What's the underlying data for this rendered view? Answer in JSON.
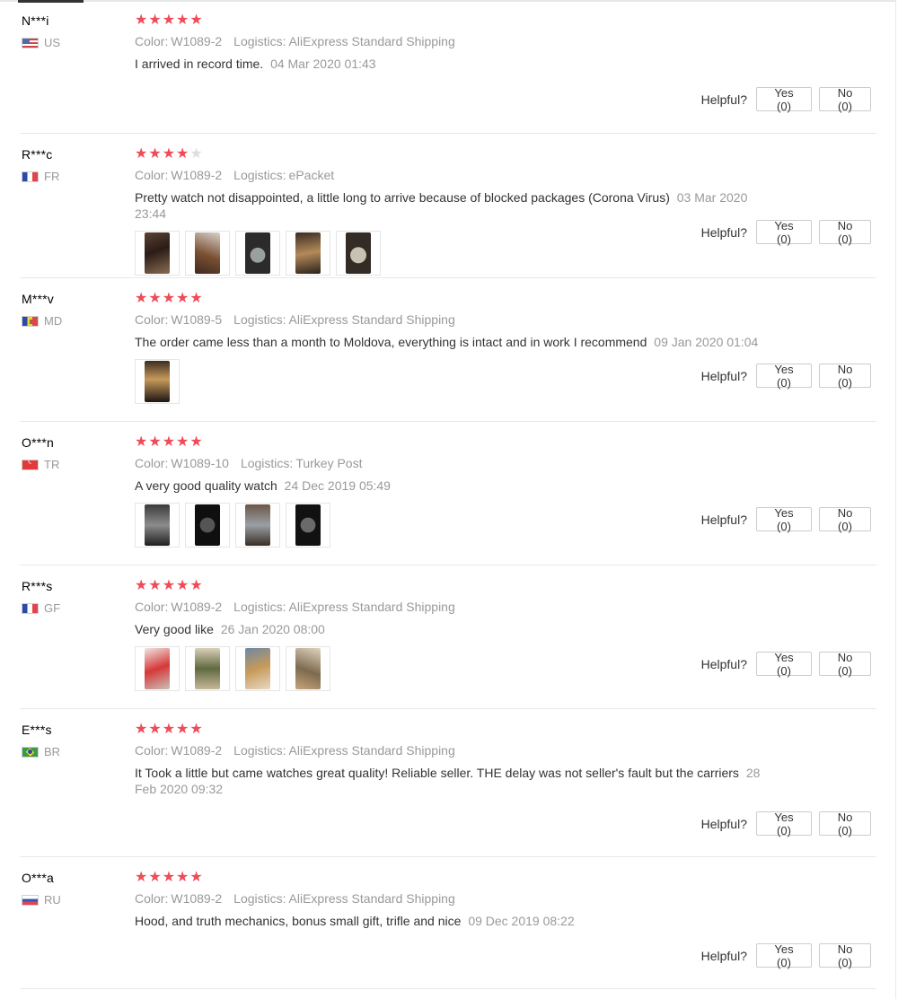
{
  "labels": {
    "color": "Color:",
    "logistics": "Logistics:",
    "helpful": "Helpful?"
  },
  "accent": {
    "star": "#ef4b59",
    "star_empty": "#dddddd"
  },
  "reviews": [
    {
      "user": "N***i",
      "country": "US",
      "flag_icon": "flag-us-icon",
      "rating": 5,
      "color": "W1089-2",
      "logistics": "AliExpress Standard Shipping",
      "text": "I arrived in record time.",
      "date": "04 Mar 2020 01:43",
      "photos": [],
      "yes": "Yes (0)",
      "no": "No (0)"
    },
    {
      "user": "R***c",
      "country": "FR",
      "flag_icon": "flag-fr-icon",
      "rating": 4,
      "color": "W1089-2",
      "logistics": "ePacket",
      "text": "Pretty watch not disappointed, a little long to arrive because of blocked packages (Corona Virus)",
      "date": "03 Mar 2020 23:44",
      "photos": [
        "t1",
        "t2",
        "t3",
        "t4",
        "t5"
      ],
      "yes": "Yes (0)",
      "no": "No (0)"
    },
    {
      "user": "M***v",
      "country": "MD",
      "flag_icon": "flag-md-icon",
      "rating": 5,
      "color": "W1089-5",
      "logistics": "AliExpress Standard Shipping",
      "text": "The order came less than a month to Moldova, everything is intact and in work I recommend",
      "date": "09 Jan 2020 01:04",
      "photos": [
        "t6"
      ],
      "yes": "Yes (0)",
      "no": "No (0)"
    },
    {
      "user": "O***n",
      "country": "TR",
      "flag_icon": "flag-tr-icon",
      "rating": 5,
      "color": "W1089-10",
      "logistics": "Turkey Post",
      "text": "A very good quality watch",
      "date": "24 Dec 2019 05:49",
      "photos": [
        "t7",
        "t8",
        "t9",
        "t10"
      ],
      "yes": "Yes (0)",
      "no": "No (0)"
    },
    {
      "user": "R***s",
      "country": "GF",
      "flag_icon": "flag-fr-icon",
      "rating": 5,
      "color": "W1089-2",
      "logistics": "AliExpress Standard Shipping",
      "text": "Very good like",
      "date": "26 Jan 2020 08:00",
      "photos": [
        "t11",
        "t12",
        "t13",
        "t14"
      ],
      "yes": "Yes (0)",
      "no": "No (0)"
    },
    {
      "user": "E***s",
      "country": "BR",
      "flag_icon": "flag-br-icon",
      "rating": 5,
      "color": "W1089-2",
      "logistics": "AliExpress Standard Shipping",
      "text": "It Took a little but came watches great quality! Reliable seller. THE delay was not seller's fault but the carriers",
      "date": "28 Feb 2020 09:32",
      "photos": [],
      "yes": "Yes (0)",
      "no": "No (0)"
    },
    {
      "user": "O***a",
      "country": "RU",
      "flag_icon": "flag-ru-icon",
      "rating": 5,
      "color": "W1089-2",
      "logistics": "AliExpress Standard Shipping",
      "text": "Hood, and truth mechanics, bonus small gift, trifle and nice",
      "date": "09 Dec 2019 08:22",
      "photos": [],
      "yes": "Yes (0)",
      "no": "No (0)"
    }
  ]
}
